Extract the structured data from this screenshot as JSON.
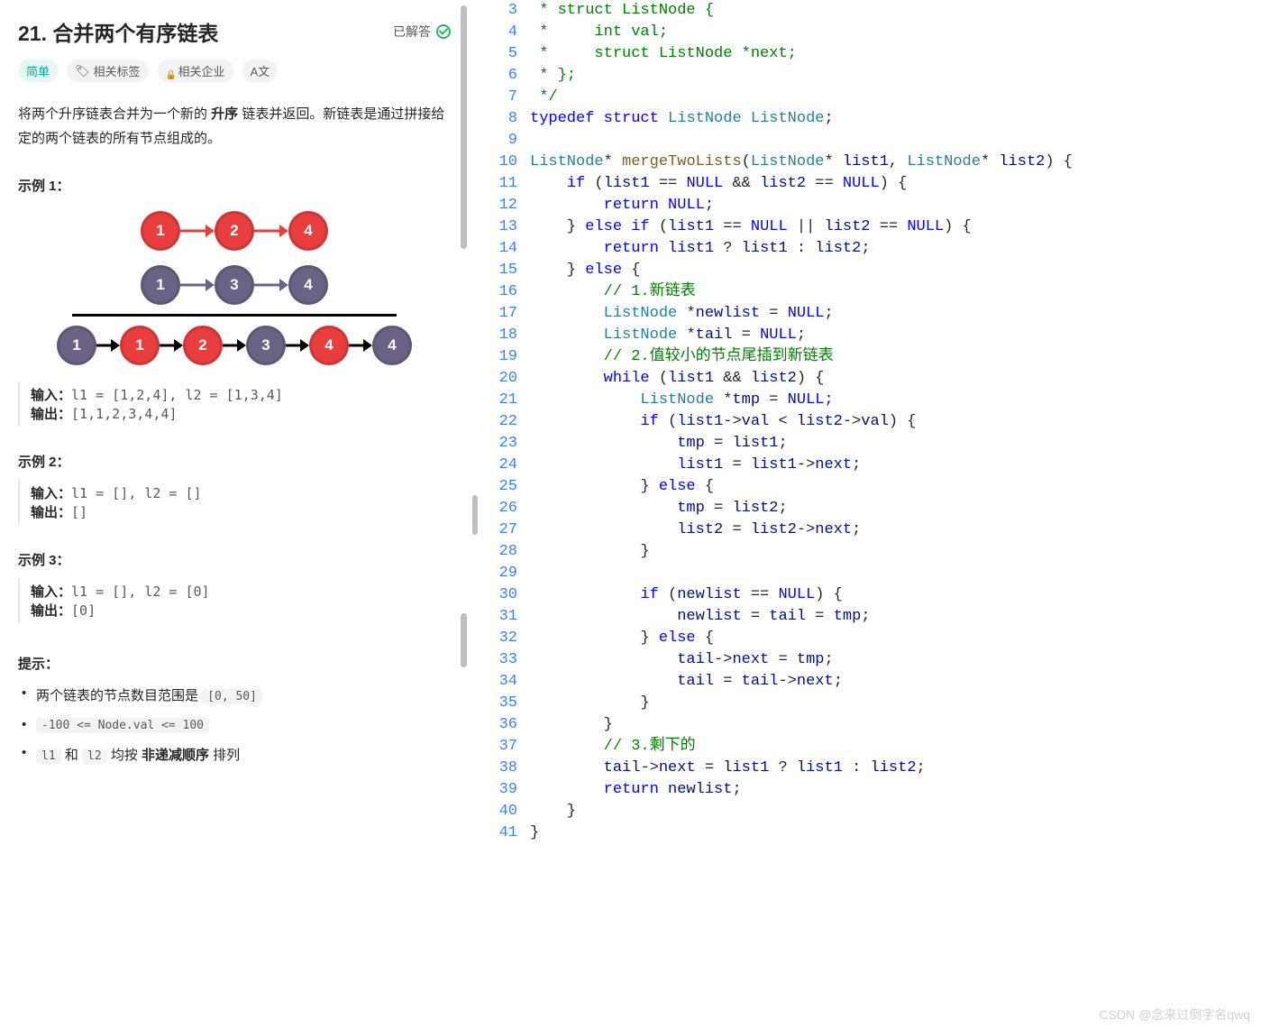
{
  "problem": {
    "number": "21.",
    "title": "合并两个有序链表",
    "solved_label": "已解答",
    "difficulty": "简单",
    "tag_related": "相关标签",
    "tag_company": "相关企业",
    "tag_translate_icon": "A文",
    "desc_part1": "将两个升序链表合并为一个新的 ",
    "desc_bold": "升序",
    "desc_part2": " 链表并返回。新链表是通过拼接给定的两个链表的所有节点组成的。"
  },
  "examples": [
    {
      "heading": "示例 1：",
      "input_label": "输入：",
      "input": "l1 = [1,2,4], l2 = [1,3,4]",
      "output_label": "输出：",
      "output": "[1,1,2,3,4,4]"
    },
    {
      "heading": "示例 2：",
      "input_label": "输入：",
      "input": "l1 = [], l2 = []",
      "output_label": "输出：",
      "output": "[]"
    },
    {
      "heading": "示例 3：",
      "input_label": "输入：",
      "input": "l1 = [], l2 = [0]",
      "output_label": "输出：",
      "output": "[0]"
    }
  ],
  "hints": {
    "heading": "提示：",
    "h1_pre": "两个链表的节点数目范围是 ",
    "h1_code": "[0, 50]",
    "h2_code": "-100 <= Node.val <= 100",
    "h3_a": "l1",
    "h3_mid": " 和 ",
    "h3_b": "l2",
    "h3_post_pre": " 均按 ",
    "h3_bold": "非递减顺序",
    "h3_post": " 排列"
  },
  "diagram": {
    "list1": [
      "1",
      "2",
      "4"
    ],
    "list2": [
      "1",
      "3",
      "4"
    ],
    "merged": [
      "1",
      "1",
      "2",
      "3",
      "4",
      "4"
    ]
  },
  "code_lines": [
    {
      "n": 3,
      "html": "<span class='tok-cm'> * struct ListNode {</span>"
    },
    {
      "n": 4,
      "html": "<span class='tok-cm'> *     int val;</span>"
    },
    {
      "n": 5,
      "html": "<span class='tok-cm'> *     struct ListNode *next;</span>"
    },
    {
      "n": 6,
      "html": "<span class='tok-cm'> * };</span>"
    },
    {
      "n": 7,
      "html": "<span class='tok-cm'> */</span>"
    },
    {
      "n": 8,
      "html": "<span class='tok-kw'>typedef</span> <span class='tok-kw'>struct</span> <span class='tok-ty'>ListNode</span> <span class='tok-ty'>ListNode</span>;"
    },
    {
      "n": 9,
      "html": ""
    },
    {
      "n": 10,
      "html": "<span class='tok-ty'>ListNode</span>* <span class='tok-fn'>mergeTwoLists</span>(<span class='tok-ty'>ListNode</span>* <span class='tok-var'>list1</span>, <span class='tok-ty'>ListNode</span>* <span class='tok-var'>list2</span>) {"
    },
    {
      "n": 11,
      "html": "    <span class='tok-kw'>if</span> (<span class='tok-var'>list1</span> == <span class='tok-null'>NULL</span> &amp;&amp; <span class='tok-var'>list2</span> == <span class='tok-null'>NULL</span>) {"
    },
    {
      "n": 12,
      "html": "        <span class='tok-kw'>return</span> <span class='tok-null'>NULL</span>;"
    },
    {
      "n": 13,
      "html": "    } <span class='tok-kw'>else if</span> (<span class='tok-var'>list1</span> == <span class='tok-null'>NULL</span> || <span class='tok-var'>list2</span> == <span class='tok-null'>NULL</span>) {"
    },
    {
      "n": 14,
      "html": "        <span class='tok-kw'>return</span> <span class='tok-var'>list1</span> ? <span class='tok-var'>list1</span> : <span class='tok-var'>list2</span>;"
    },
    {
      "n": 15,
      "html": "    } <span class='tok-kw'>else</span> {"
    },
    {
      "n": 16,
      "html": "        <span class='tok-cm'>// 1.新链表</span>"
    },
    {
      "n": 17,
      "html": "        <span class='tok-ty'>ListNode</span> *<span class='tok-var'>newlist</span> = <span class='tok-null'>NULL</span>;"
    },
    {
      "n": 18,
      "html": "        <span class='tok-ty'>ListNode</span> *<span class='tok-var'>tail</span> = <span class='tok-null'>NULL</span>;"
    },
    {
      "n": 19,
      "html": "        <span class='tok-cm'>// 2.值较小的节点尾插到新链表</span>"
    },
    {
      "n": 20,
      "html": "        <span class='tok-kw'>while</span> (<span class='tok-var'>list1</span> &amp;&amp; <span class='tok-var'>list2</span>) {"
    },
    {
      "n": 21,
      "html": "            <span class='tok-ty'>ListNode</span> *<span class='tok-var'>tmp</span> = <span class='tok-null'>NULL</span>;"
    },
    {
      "n": 22,
      "html": "            <span class='tok-kw'>if</span> (<span class='tok-var'>list1</span>-&gt;<span class='tok-var'>val</span> &lt; <span class='tok-var'>list2</span>-&gt;<span class='tok-var'>val</span>) {"
    },
    {
      "n": 23,
      "html": "                <span class='tok-var'>tmp</span> = <span class='tok-var'>list1</span>;"
    },
    {
      "n": 24,
      "html": "                <span class='tok-var'>list1</span> = <span class='tok-var'>list1</span>-&gt;<span class='tok-var'>next</span>;"
    },
    {
      "n": 25,
      "html": "            } <span class='tok-kw'>else</span> {"
    },
    {
      "n": 26,
      "html": "                <span class='tok-var'>tmp</span> = <span class='tok-var'>list2</span>;"
    },
    {
      "n": 27,
      "html": "                <span class='tok-var'>list2</span> = <span class='tok-var'>list2</span>-&gt;<span class='tok-var'>next</span>;"
    },
    {
      "n": 28,
      "html": "            }"
    },
    {
      "n": 29,
      "html": ""
    },
    {
      "n": 30,
      "html": "            <span class='tok-kw'>if</span> (<span class='tok-var'>newlist</span> == <span class='tok-null'>NULL</span>) {"
    },
    {
      "n": 31,
      "html": "                <span class='tok-var'>newlist</span> = <span class='tok-var'>tail</span> = <span class='tok-var'>tmp</span>;"
    },
    {
      "n": 32,
      "html": "            } <span class='tok-kw'>else</span> {"
    },
    {
      "n": 33,
      "html": "                <span class='tok-var'>tail</span>-&gt;<span class='tok-var'>next</span> = <span class='tok-var'>tmp</span>;"
    },
    {
      "n": 34,
      "html": "                <span class='tok-var'>tail</span> = <span class='tok-var'>tail</span>-&gt;<span class='tok-var'>next</span>;"
    },
    {
      "n": 35,
      "html": "            }"
    },
    {
      "n": 36,
      "html": "        }"
    },
    {
      "n": 37,
      "html": "        <span class='tok-cm'>// 3.剩下的</span>"
    },
    {
      "n": 38,
      "html": "        <span class='tok-var'>tail</span>-&gt;<span class='tok-var'>next</span> = <span class='tok-var'>list1</span> ? <span class='tok-var'>list1</span> : <span class='tok-var'>list2</span>;"
    },
    {
      "n": 39,
      "html": "        <span class='tok-kw'>return</span> <span class='tok-var'>newlist</span>;"
    },
    {
      "n": 40,
      "html": "    }"
    },
    {
      "n": 41,
      "html": "}"
    }
  ],
  "watermark": "CSDN @念来过倒字名qwq"
}
